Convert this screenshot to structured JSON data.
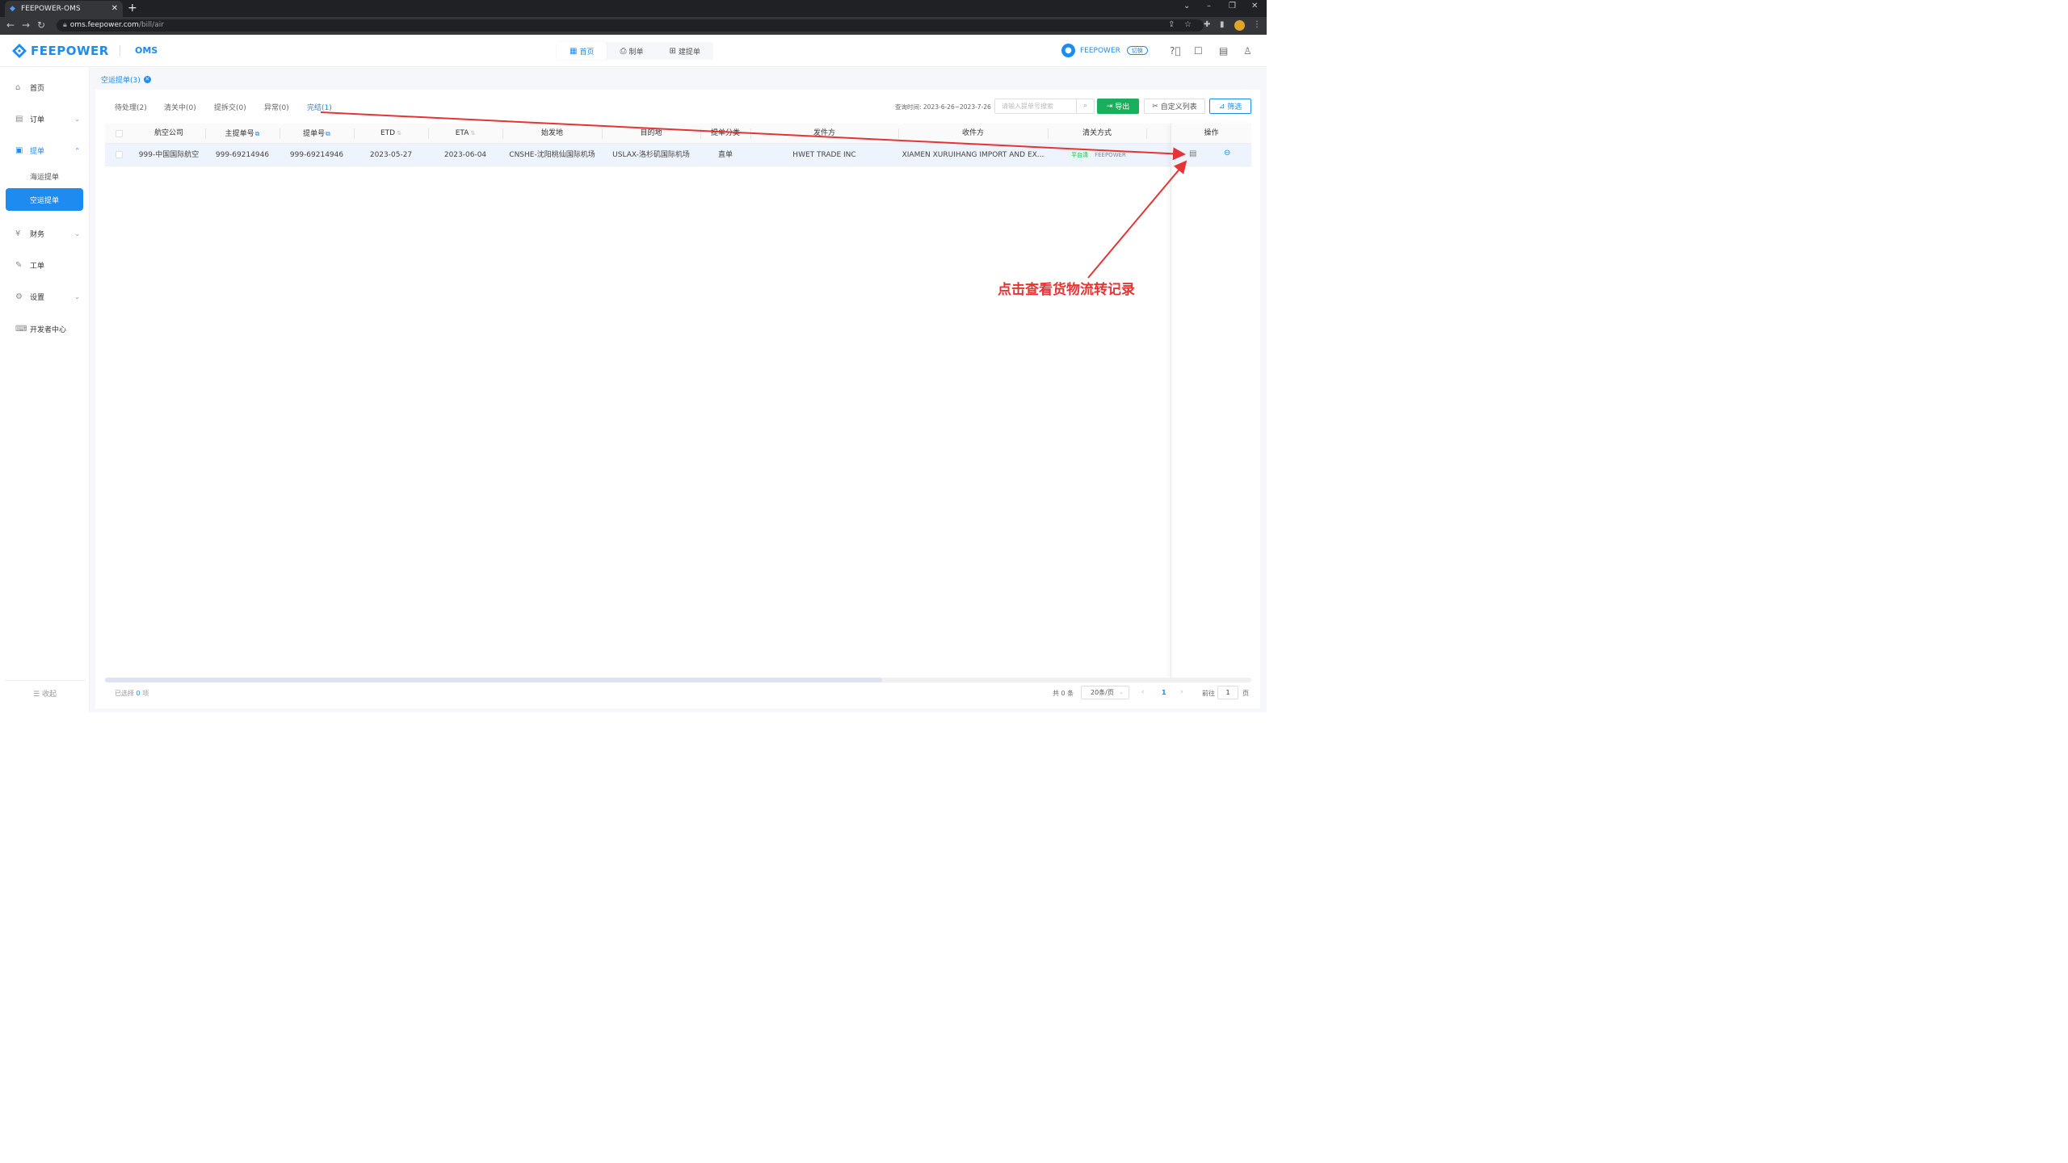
{
  "browser": {
    "tab_title": "FEEPOWER-OMS",
    "url_host": "oms.feepower.com",
    "url_path": "/bill/air"
  },
  "header": {
    "brand": "FEEPOWER",
    "app_name": "OMS",
    "nav": [
      {
        "label": "首页",
        "active": true
      },
      {
        "label": "制单",
        "active": false
      },
      {
        "label": "建提单",
        "active": false
      }
    ],
    "user_name": "FEEPOWER",
    "switch_label": "切换"
  },
  "sidebar": {
    "items": [
      {
        "label": "首页"
      },
      {
        "label": "订单"
      },
      {
        "label": "提单"
      },
      {
        "label": "财务"
      },
      {
        "label": "工单"
      },
      {
        "label": "设置"
      },
      {
        "label": "开发者中心"
      }
    ],
    "sub_items": [
      {
        "label": "海运提单"
      },
      {
        "label": "空运提单"
      }
    ],
    "collapse_label": "收起"
  },
  "page_tab": {
    "label": "空运提单(3)"
  },
  "status_tabs": [
    {
      "label": "待处理(2)"
    },
    {
      "label": "清关中(0)"
    },
    {
      "label": "提拆交(0)"
    },
    {
      "label": "异常(0)"
    },
    {
      "label": "完结(1)"
    }
  ],
  "toolbar": {
    "query_time": "查询时间: 2023-6-26~2023-7-26",
    "search_placeholder": "请输入提单号搜索",
    "export_label": "导出",
    "custom_columns_label": "自定义列表",
    "filter_label": "筛选"
  },
  "table": {
    "columns": [
      "航空公司",
      "主提单号",
      "提单号",
      "ETD",
      "ETA",
      "始发地",
      "目的地",
      "提单分类",
      "发件方",
      "收件方",
      "清关方式",
      "操作"
    ],
    "rows": [
      {
        "airline": "999-中国国际航空",
        "master_no": "999-69214946",
        "bill_no": "999-69214946",
        "etd": "2023-05-27",
        "eta": "2023-06-04",
        "origin": "CNSHE-沈阳桃仙国际机场",
        "destination": "USLAX-洛杉矶国际机场",
        "category": "直单",
        "shipper": "HWET TRADE INC",
        "consignee": "XIAMEN XURUIHANG IMPORT AND EX...",
        "clearance_tag": "平台清",
        "clearance_agent": "FEEPOWER"
      }
    ]
  },
  "footer": {
    "selected_prefix": "已选择",
    "selected_count": "0",
    "selected_suffix": "项",
    "total": "共 0 条",
    "page_size": "20条/页",
    "current_page": "1",
    "goto_label": "前往",
    "goto_value": "1",
    "page_word": "页"
  },
  "annotation": {
    "text": "点击查看货物流转记录",
    "color": "#e43434"
  },
  "colors": {
    "primary": "#1d8bf0",
    "export_green": "#1aaf5d"
  }
}
